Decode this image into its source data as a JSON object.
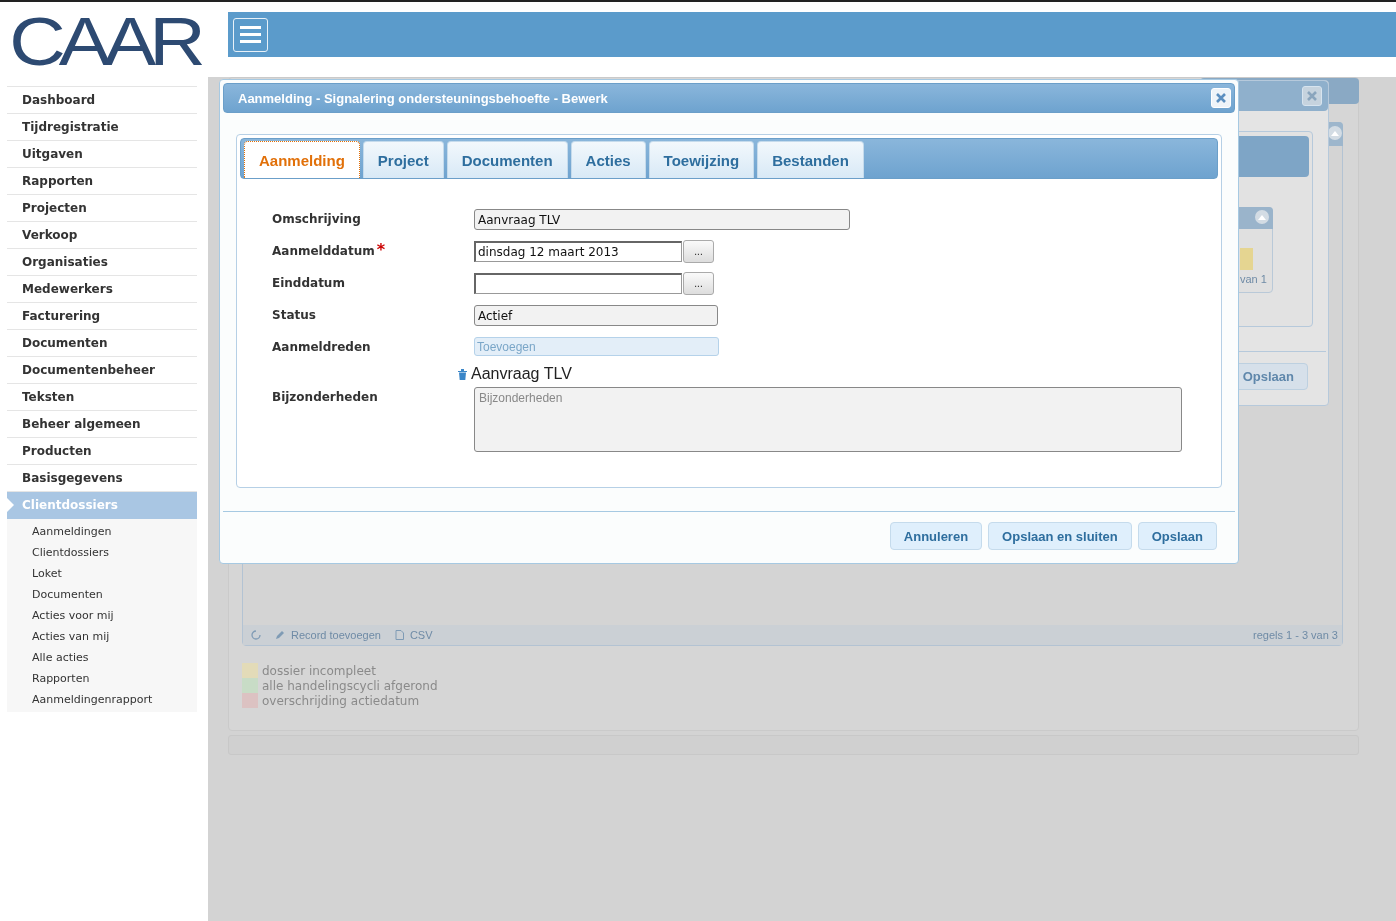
{
  "logo": {
    "text": "CAAR"
  },
  "sidebar": {
    "items": [
      {
        "label": "Dashboard",
        "selected": false
      },
      {
        "label": "Tijdregistratie",
        "selected": false
      },
      {
        "label": "Uitgaven",
        "selected": false
      },
      {
        "label": "Rapporten",
        "selected": false
      },
      {
        "label": "Projecten",
        "selected": false
      },
      {
        "label": "Verkoop",
        "selected": false
      },
      {
        "label": "Organisaties",
        "selected": false
      },
      {
        "label": "Medewerkers",
        "selected": false
      },
      {
        "label": "Facturering",
        "selected": false
      },
      {
        "label": "Documenten",
        "selected": false
      },
      {
        "label": "Documentenbeheer",
        "selected": false
      },
      {
        "label": "Teksten",
        "selected": false
      },
      {
        "label": "Beheer algemeen",
        "selected": false
      },
      {
        "label": "Producten",
        "selected": false
      },
      {
        "label": "Basisgegevens",
        "selected": false
      },
      {
        "label": "Clientdossiers",
        "selected": true,
        "children": [
          {
            "label": "Aanmeldingen"
          },
          {
            "label": "Clientdossiers"
          },
          {
            "label": "Loket"
          },
          {
            "label": "Documenten"
          },
          {
            "label": "Acties voor mij"
          },
          {
            "label": "Acties van mij"
          },
          {
            "label": "Alle acties"
          },
          {
            "label": "Rapporten"
          },
          {
            "label": "Aanmeldingenrapport"
          }
        ]
      }
    ]
  },
  "background": {
    "grid_footer": {
      "actions": [
        {
          "kind": "edit",
          "label": "Record toevoegen"
        },
        {
          "kind": "file",
          "label": "CSV"
        }
      ],
      "paging": "regels 1 - 3 van 3"
    },
    "legend": [
      {
        "label": "dossier incompleet",
        "color": "#e3dbb8"
      },
      {
        "label": "alle handelingscycli afgerond",
        "color": "#c8dcc6"
      },
      {
        "label": "overschrijding actiedatum",
        "color": "#dcc2c2"
      }
    ],
    "dialog": {
      "paging": "van 1",
      "buttons": [
        "Opslaan"
      ]
    }
  },
  "dialog": {
    "title": "Aanmelding - Signalering ondersteuningsbehoefte - Bewerk",
    "tabs": [
      {
        "label": "Aanmelding",
        "selected": true
      },
      {
        "label": "Project",
        "selected": false
      },
      {
        "label": "Documenten",
        "selected": false
      },
      {
        "label": "Acties",
        "selected": false
      },
      {
        "label": "Toewijzing",
        "selected": false
      },
      {
        "label": "Bestanden",
        "selected": false
      }
    ],
    "fields": [
      {
        "kind": "text",
        "label": "Omschrijving",
        "value": "Aanvraag TLV"
      },
      {
        "kind": "date",
        "label": "Aanmelddatum",
        "required_mark": "*",
        "value": "dinsdag 12 maart 2013",
        "button": "..."
      },
      {
        "kind": "date",
        "label": "Einddatum",
        "button": "..."
      },
      {
        "kind": "select",
        "label": "Status",
        "value": "Actief"
      },
      {
        "kind": "add",
        "label": "Aanmeldreden",
        "placeholder": "Toevoegen"
      },
      {
        "kind": "tag",
        "value": "Aanvraag TLV"
      },
      {
        "kind": "textarea",
        "label": "Bijzonderheden",
        "placeholder": "Bijzonderheden"
      }
    ],
    "buttons": [
      "Annuleren",
      "Opslaan en sluiten",
      "Opslaan"
    ]
  }
}
